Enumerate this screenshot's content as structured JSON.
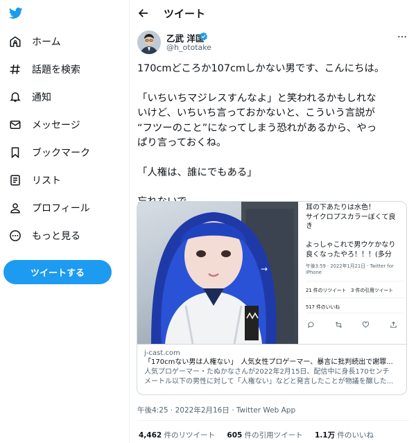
{
  "colors": {
    "accent": "#1d9bf0",
    "text": "#0f1419",
    "muted": "#536471"
  },
  "sidebar": {
    "logo": "twitter-bird-icon",
    "items": [
      {
        "label": "ホーム",
        "icon": "home-icon"
      },
      {
        "label": "話題を検索",
        "icon": "hashtag-icon"
      },
      {
        "label": "通知",
        "icon": "bell-icon"
      },
      {
        "label": "メッセージ",
        "icon": "envelope-icon"
      },
      {
        "label": "ブックマーク",
        "icon": "bookmark-icon"
      },
      {
        "label": "リスト",
        "icon": "list-icon"
      },
      {
        "label": "プロフィール",
        "icon": "person-icon"
      },
      {
        "label": "もっと見る",
        "icon": "more-circle-icon"
      }
    ],
    "tweet_button": "ツイートする"
  },
  "header": {
    "title": "ツイート"
  },
  "tweet": {
    "author_name": "乙武 洋匡",
    "author_handle": "@h_ototake",
    "lines": [
      "170cmどころか107cmしかない男です、こんにちは。",
      "",
      "「いちいちマジレスすんなよ」と笑われるかもしれな",
      "いけど、いちいち言っておかないと、こういう言説が",
      "“フツーのこと”になってしまう恐れがあるから、やっ",
      "ぱり言っておくね。",
      "",
      "「人権は、誰にでもある」",
      "",
      "忘れないで。"
    ],
    "card": {
      "inner_tweet_text": [
        "耳の下あたりは水色！",
        "サイクロプスカラーぼくて良",
        "き",
        "",
        "よっしゃこれで男ウケかなり",
        "良くなったやろ！！！(多分"
      ],
      "inner_meta": [
        "午後3:59 · 2022年1月21日 · Twitter for",
        "iPhone"
      ],
      "inner_stats1": "21 件のリツイート　3 件の引用ツイート",
      "inner_stats2": "517 件のいいね",
      "domain": "j-cast.com",
      "title": "「170cmない男は人権ない」　人気女性プロゲーマー、暴言に批判続出で謝罪...",
      "desc_line1": "人気プロゲーマー・たぬかなさんが2022年2月15日、配信中に身長170センチ",
      "desc_line2": "メートル以下の男性に対して「人権ない」などと発言したことが物議を醸した..."
    },
    "timestamp": "午後4:25 · 2022年2月16日 · Twitter Web App",
    "stats": {
      "retweets_num": "4,462",
      "retweets_label": "件のリツイート",
      "quotes_num": "605",
      "quotes_label": "件の引用ツイート",
      "likes_num": "1.1万",
      "likes_label": "件のいいね"
    }
  }
}
